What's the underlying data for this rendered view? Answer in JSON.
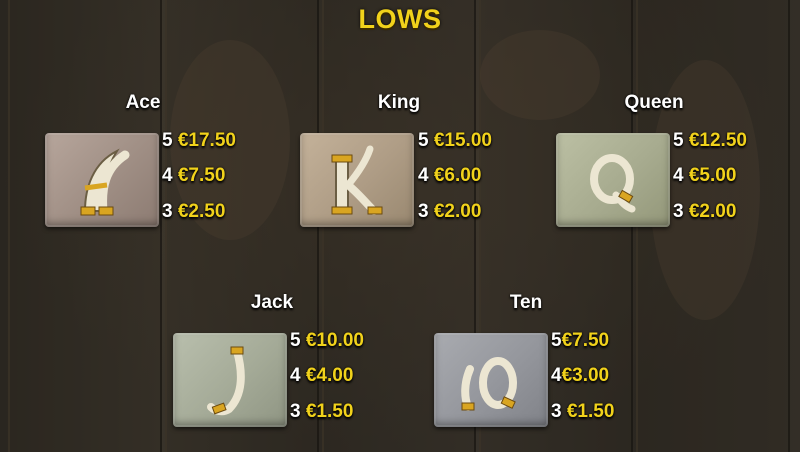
{
  "title": "LOWS",
  "symbols": [
    {
      "name": "Ace",
      "glyph": "A",
      "payouts": [
        {
          "count": "5",
          "amount": "€17.50"
        },
        {
          "count": "4",
          "amount": "€7.50"
        },
        {
          "count": "3",
          "amount": "€2.50"
        }
      ]
    },
    {
      "name": "King",
      "glyph": "K",
      "payouts": [
        {
          "count": "5",
          "amount": "€15.00"
        },
        {
          "count": "4",
          "amount": "€6.00"
        },
        {
          "count": "3",
          "amount": "€2.00"
        }
      ]
    },
    {
      "name": "Queen",
      "glyph": "Q",
      "payouts": [
        {
          "count": "5",
          "amount": "€12.50"
        },
        {
          "count": "4",
          "amount": "€5.00"
        },
        {
          "count": "3",
          "amount": "€2.00"
        }
      ]
    },
    {
      "name": "Jack",
      "glyph": "J",
      "payouts": [
        {
          "count": "5",
          "amount": "€10.00"
        },
        {
          "count": "4",
          "amount": "€4.00"
        },
        {
          "count": "3",
          "amount": "€1.50"
        }
      ]
    },
    {
      "name": "Ten",
      "glyph": "10",
      "payouts": [
        {
          "count": "5",
          "amount": "€7.50"
        },
        {
          "count": "4",
          "amount": "€3.00"
        },
        {
          "count": "3",
          "amount": "€1.50"
        }
      ]
    }
  ],
  "colors": {
    "title": "#f1d21b",
    "amount": "#f1d21b",
    "label": "#ffffff",
    "ivory": "#e9e3cf",
    "gold": "#d9a521"
  }
}
